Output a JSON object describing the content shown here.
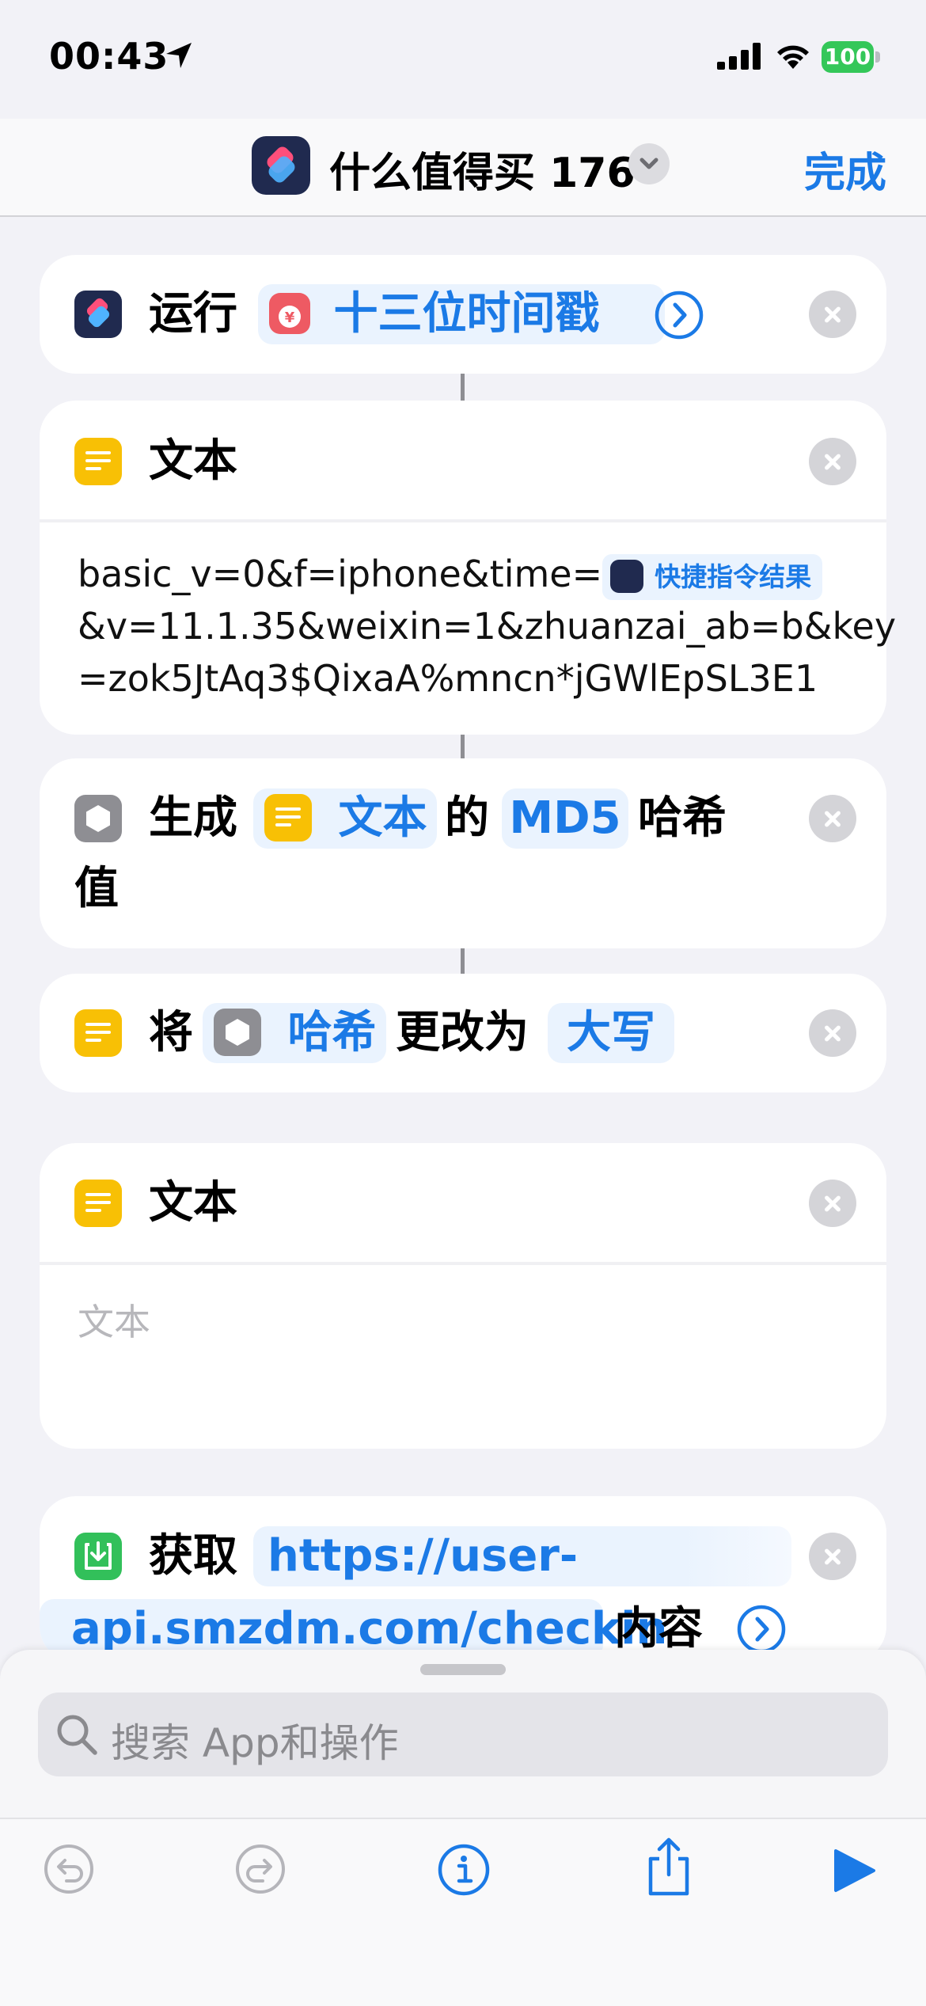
{
  "status_bar": {
    "time": "00:43",
    "battery": "100"
  },
  "nav": {
    "title": "什么值得买 176",
    "done": "完成"
  },
  "actions": {
    "run": {
      "label": "运行",
      "target": "十三位时间戳"
    },
    "text1": {
      "label": "文本",
      "lines": [
        "basic_v=0&f=iphone&time=",
        "&v=11.1.35&weixin=1&zhuanzai_ab=b&key",
        "=zok5JtAq3$QixaA%mncn*jGWlEpSL3E1"
      ],
      "variable": "快捷指令结果"
    },
    "md5": {
      "verb": "生成",
      "input": "文本",
      "of": "的",
      "algo": "MD5",
      "suffix": "哈希",
      "suffix2": "值"
    },
    "case": {
      "verb": "将",
      "input": "哈希",
      "change": "更改为",
      "target": "大写"
    },
    "text2": {
      "label": "文本",
      "placeholder": "文本"
    },
    "get": {
      "verb": "获取",
      "url_part1": "https://user-",
      "url_part2": "api.smzdm.com/checkin",
      "suffix": "内容"
    }
  },
  "search": {
    "placeholder": "搜索 App和操作"
  },
  "colors": {
    "accent": "#1b7ae6",
    "text_yellow": "#f8c005",
    "battery_green": "#34c759"
  },
  "icons": [
    "location-arrow-icon",
    "cellular-icon",
    "wifi-icon",
    "undo-icon",
    "redo-icon",
    "info-icon",
    "share-icon",
    "play-icon"
  ]
}
